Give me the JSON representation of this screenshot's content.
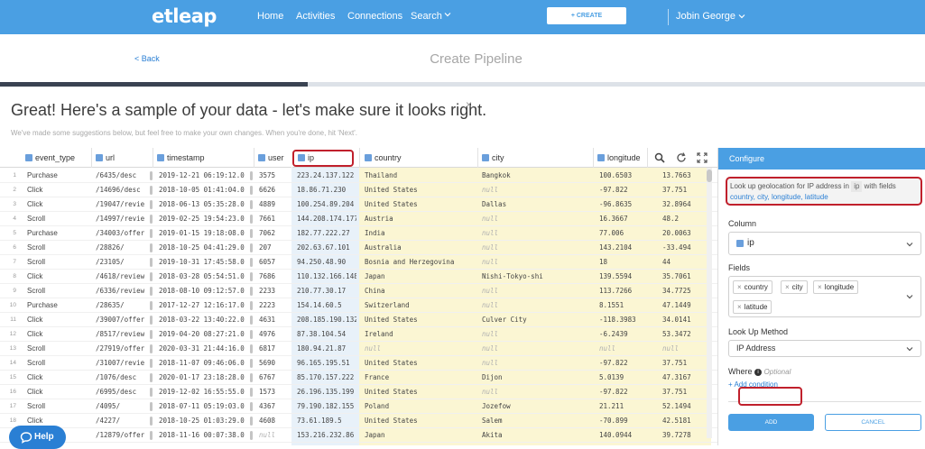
{
  "nav": {
    "logo": "etleap",
    "home": "Home",
    "activities": "Activities",
    "connections": "Connections",
    "search": "Search",
    "create": "+ CREATE",
    "user": "Jobin George"
  },
  "header": {
    "back": "< Back",
    "title": "Create Pipeline",
    "progress": 0.333
  },
  "message": {
    "headline": "Great! Here's a sample of your data - let's make sure it looks right.",
    "close": "×",
    "subline": "We've made some suggestions below, but feel free to make your own changes. When you're done, hit 'Next'."
  },
  "table": {
    "columns": [
      "event_type",
      "url",
      "timestamp",
      "user",
      "ip",
      "country",
      "city",
      "longitude",
      ""
    ],
    "rows": [
      [
        "1",
        "Purchase",
        "/6435/desc",
        "2019-12-21 06:19:12.0",
        "3575",
        "223.24.137.122",
        "Thailand",
        "Bangkok",
        "100.6503",
        "13.7663"
      ],
      [
        "2",
        "Click",
        "/14696/desc",
        "2018-10-05 01:41:04.0",
        "6626",
        "18.86.71.230",
        "United States",
        "null",
        "-97.822",
        "37.751"
      ],
      [
        "3",
        "Click",
        "/19047/revie",
        "2018-06-13 05:35:28.0",
        "4889",
        "100.254.89.204",
        "United States",
        "Dallas",
        "-96.8635",
        "32.8964"
      ],
      [
        "4",
        "Scroll",
        "/14997/revie",
        "2019-02-25 19:54:23.0",
        "7661",
        "144.208.174.177",
        "Austria",
        "null",
        "16.3667",
        "48.2"
      ],
      [
        "5",
        "Purchase",
        "/34003/offer",
        "2019-01-15 19:18:08.0",
        "7062",
        "182.77.222.27",
        "India",
        "null",
        "77.006",
        "20.0063"
      ],
      [
        "6",
        "Scroll",
        "/28826/",
        "2018-10-25 04:41:29.0",
        "207",
        "202.63.67.101",
        "Australia",
        "null",
        "143.2104",
        "-33.494"
      ],
      [
        "7",
        "Scroll",
        "/23105/",
        "2019-10-31 17:45:58.0",
        "6057",
        "94.250.48.90",
        "Bosnia and Herzegovina",
        "null",
        "18",
        "44"
      ],
      [
        "8",
        "Click",
        "/4618/review",
        "2018-03-28 05:54:51.0",
        "7686",
        "110.132.166.148",
        "Japan",
        "Nishi-Tokyo-shi",
        "139.5594",
        "35.7061"
      ],
      [
        "9",
        "Scroll",
        "/6336/review",
        "2018-08-10 09:12:57.0",
        "2233",
        "210.77.30.17",
        "China",
        "null",
        "113.7266",
        "34.7725"
      ],
      [
        "10",
        "Purchase",
        "/28635/",
        "2017-12-27 12:16:17.0",
        "2223",
        "154.14.60.5",
        "Switzerland",
        "null",
        "8.1551",
        "47.1449"
      ],
      [
        "11",
        "Click",
        "/39007/offer",
        "2018-03-22 13:40:22.0",
        "4631",
        "208.185.190.132",
        "United States",
        "Culver City",
        "-118.3983",
        "34.0141"
      ],
      [
        "12",
        "Click",
        "/8517/review",
        "2019-04-20 08:27:21.0",
        "4976",
        "87.38.104.54",
        "Ireland",
        "null",
        "-6.2439",
        "53.3472"
      ],
      [
        "13",
        "Scroll",
        "/27919/offer",
        "2020-03-31 21:44:16.0",
        "6817",
        "180.94.21.87",
        "null",
        "null",
        "null",
        "null"
      ],
      [
        "14",
        "Scroll",
        "/31007/revie",
        "2018-11-07 09:46:06.0",
        "5690",
        "96.165.195.51",
        "United States",
        "null",
        "-97.822",
        "37.751"
      ],
      [
        "15",
        "Click",
        "/1076/desc",
        "2020-01-17 23:18:28.0",
        "6767",
        "85.170.157.222",
        "France",
        "Dijon",
        "5.0139",
        "47.3167"
      ],
      [
        "16",
        "Click",
        "/6995/desc",
        "2019-12-02 16:55:55.0",
        "1573",
        "26.196.135.199",
        "United States",
        "null",
        "-97.822",
        "37.751"
      ],
      [
        "17",
        "Scroll",
        "/4095/",
        "2018-07-11 05:19:03.0",
        "4367",
        "79.190.182.155",
        "Poland",
        "Jozefow",
        "21.211",
        "52.1494"
      ],
      [
        "18",
        "Click",
        "/4227/",
        "2018-10-25 01:03:29.0",
        "4608",
        "73.61.189.5",
        "United States",
        "Salem",
        "-70.899",
        "42.5181"
      ],
      [
        "19",
        "Click",
        "/12879/offer",
        "2018-11-16 00:07:38.0",
        "null",
        "153.216.232.86",
        "Japan",
        "Akita",
        "140.0944",
        "39.7278"
      ]
    ]
  },
  "configure": {
    "title": "Configure",
    "desc_prefix": "Look up geolocation for IP address in",
    "desc_col": "ip",
    "desc_mid": "with fields",
    "desc_fields": "country, city, longitude, latitude",
    "column_label": "Column",
    "column_value": "ip",
    "fields_label": "Fields",
    "fields": [
      "country",
      "city",
      "longitude",
      "latitude"
    ],
    "lookup_label": "Look Up Method",
    "lookup_value": "IP Address",
    "where_label": "Where",
    "where_optional": "Optional",
    "add_condition": "+ Add condition",
    "add": "ADD",
    "cancel": "CANCEL"
  },
  "help": "Help",
  "colors": {
    "nav": "#4a9fe3",
    "ip_column": "#e8f1f9",
    "added_columns": "#fbf6d3",
    "highlight": "#c0202c"
  }
}
